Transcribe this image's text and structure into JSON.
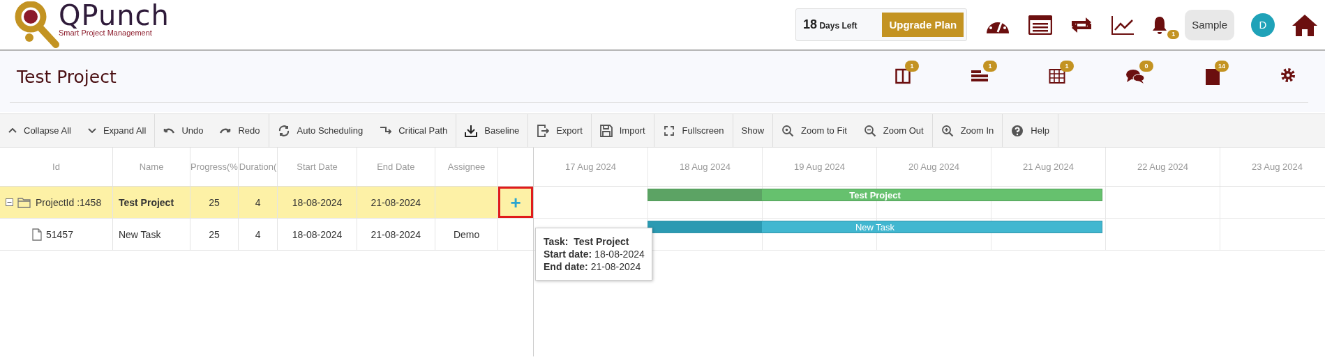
{
  "header": {
    "brand": "QPunch",
    "tagline": "Smart Project Management",
    "trial": {
      "days": "18",
      "label": "Days Left"
    },
    "upgrade_button": "Upgrade Plan",
    "notification_badge": "1",
    "workspace_button": "Sample",
    "avatar": "D"
  },
  "project": {
    "title": "Test Project",
    "tools": [
      {
        "badge": "1"
      },
      {
        "badge": "1"
      },
      {
        "badge": "1"
      },
      {
        "badge": "0"
      },
      {
        "badge": "14"
      }
    ]
  },
  "toolbar": [
    "Collapse All",
    "Expand All",
    "Undo",
    "Redo",
    "Auto Scheduling",
    "Critical Path",
    "Baseline",
    "Export",
    "Import",
    "Fullscreen",
    "Show",
    "Zoom to Fit",
    "Zoom Out",
    "Zoom In",
    "Help"
  ],
  "grid": {
    "columns": [
      "Id",
      "Name",
      "Progress(%",
      "Duration(",
      "Start Date",
      "End Date",
      "Assignee"
    ],
    "rows": [
      {
        "kind": "project",
        "expanded": true,
        "selected": true,
        "id": "ProjectId :1458",
        "name": "Test Project",
        "progress": "25",
        "duration": "4",
        "start": "18-08-2024",
        "end": "21-08-2024",
        "add_button": "+"
      },
      {
        "kind": "task",
        "selected": false,
        "id": "51457",
        "name": "New Task",
        "progress": "25",
        "duration": "4",
        "start": "18-08-2024",
        "end": "21-08-2024",
        "assignee": "Demo"
      }
    ]
  },
  "timeline": {
    "dates": [
      "17 Aug 2024",
      "18 Aug 2024",
      "19 Aug 2024",
      "20 Aug 2024",
      "21 Aug 2024",
      "22 Aug 2024",
      "23 Aug 2024"
    ],
    "bars": [
      {
        "kind": "project",
        "label": "Test Project",
        "level": 0.25
      },
      {
        "kind": "task",
        "label": "New Task",
        "level": 0.25
      }
    ]
  },
  "tooltip": {
    "lines": [
      "**Task:  Test Project**",
      "**Start date:** 18-08-2024",
      "**End date:** 21-08-2024"
    ]
  }
}
